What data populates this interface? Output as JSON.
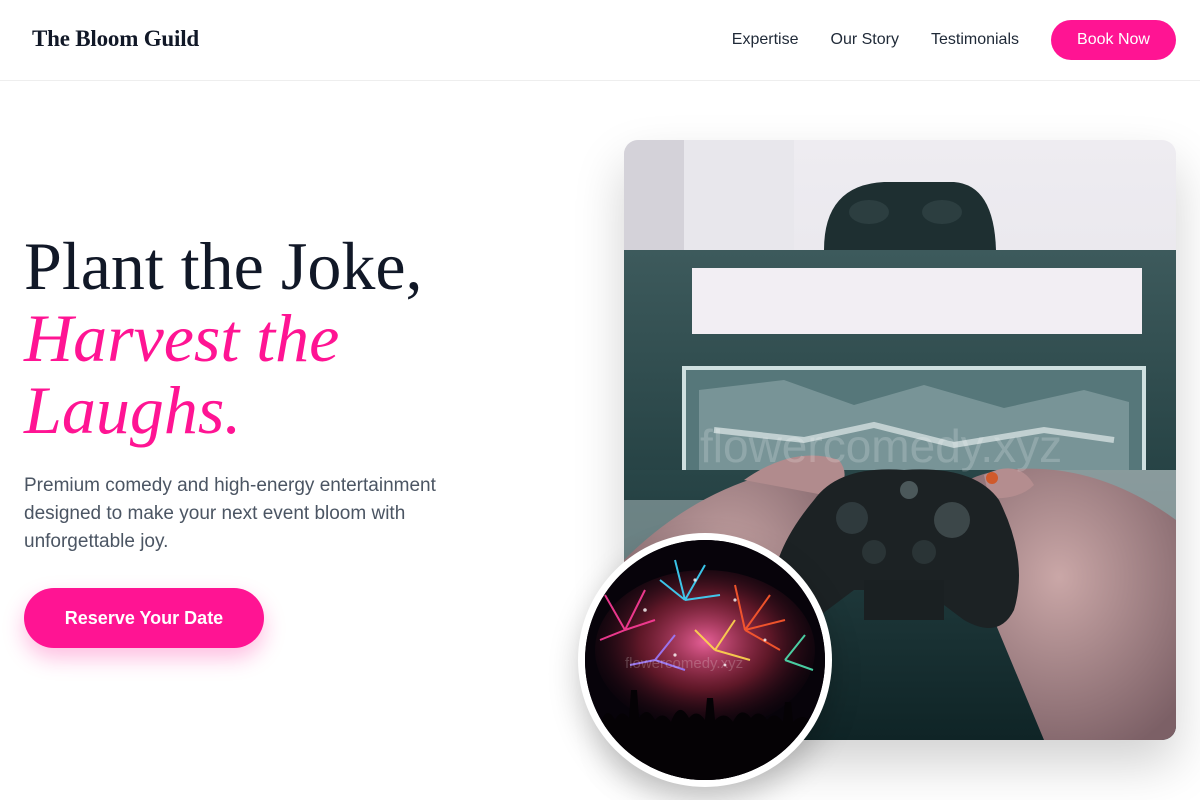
{
  "header": {
    "logo": "The Bloom Guild",
    "nav": [
      "Expertise",
      "Our Story",
      "Testimonials"
    ],
    "cta": "Book Now"
  },
  "hero": {
    "title_line1": "Plant the Joke,",
    "title_accent": "Harvest the Laughs.",
    "description": "Premium comedy and high-energy entertainment designed to make your next event bloom with unforgettable joy.",
    "cta": "Reserve Your Date"
  },
  "images": {
    "main": {
      "subject": "hands-holding-game-controller",
      "watermark": "flowercomedy.xyz"
    },
    "inset": {
      "subject": "fireworks-crowd-silhouette",
      "watermark": "flowercomedy.xyz"
    }
  },
  "colors": {
    "accent": "#ff1493",
    "heading": "#111827",
    "body_text": "#4b5563"
  }
}
